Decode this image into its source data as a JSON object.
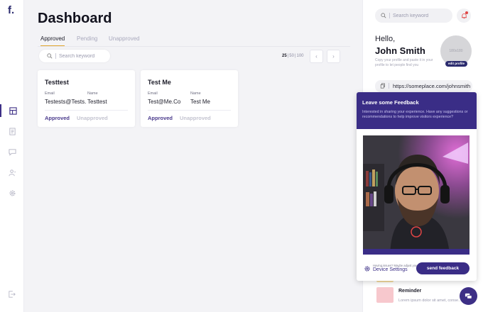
{
  "brand": {
    "logo": "f."
  },
  "nav": {
    "items": [
      {
        "name": "dashboard",
        "active": true
      },
      {
        "name": "documents",
        "active": false
      },
      {
        "name": "messages",
        "active": false
      },
      {
        "name": "users",
        "active": false
      },
      {
        "name": "settings",
        "active": false
      }
    ],
    "logout_icon": "logout-icon"
  },
  "main": {
    "title": "Dashboard",
    "tabs": [
      {
        "label": "Approved",
        "active": true
      },
      {
        "label": "Pending",
        "active": false
      },
      {
        "label": "Unapproved",
        "active": false
      }
    ],
    "search": {
      "placeholder": "Search keyword"
    },
    "pagination": {
      "sizes": [
        "25",
        "50",
        "100"
      ],
      "selected": "25",
      "prev": "‹",
      "next": "›"
    },
    "cards": [
      {
        "title": "Testtest",
        "email_label": "Email",
        "email": "Testests@Tests.com",
        "name_label": "Name",
        "name": "Testtest",
        "approved_label": "Approved",
        "unapproved_label": "Unapproved"
      },
      {
        "title": "Test Me",
        "email_label": "Email",
        "email": "Test@Me.Co",
        "name_label": "Name",
        "name": "Test Me",
        "approved_label": "Approved",
        "unapproved_label": "Unapproved"
      }
    ]
  },
  "profile": {
    "search_placeholder": "Search keyword",
    "greeting": "Hello,",
    "name": "John Smith",
    "hint": "Copy your profile and paste it in your profile to let people find you",
    "avatar_label": "180x180",
    "edit_label": "edit profile",
    "url": "https://someplace.com/johnsmith"
  },
  "reminder": {
    "title": "Reminder",
    "text": "Lorem ipsum dolor sit amet, conse..."
  },
  "feedback": {
    "title": "Leave some Feedback",
    "subtitle": "Interested in sharing your experience. Have any suggestions or recommendations to help improve visitors experience?",
    "footer_hint": "Having issues? Maybe adjust your",
    "footer_link": "Device Settings",
    "send_label": "send feedback"
  },
  "colors": {
    "accent": "#3a2d86",
    "tab_underline": "#e0a52c",
    "approved": "#4a3a8c",
    "unapproved": "#c4c4d0",
    "notification": "#e04545"
  }
}
